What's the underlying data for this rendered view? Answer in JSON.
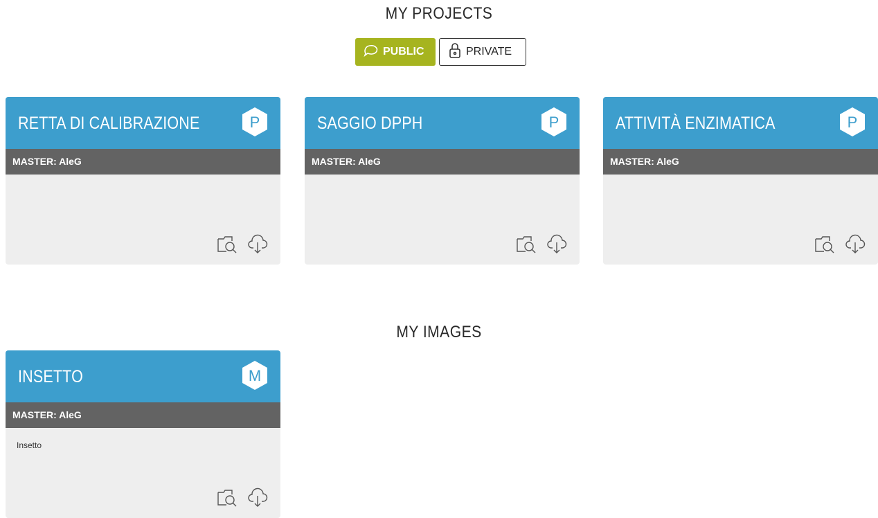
{
  "projects": {
    "title": "MY PROJECTS",
    "filters": [
      {
        "label": "PUBLIC",
        "active": true,
        "icon": "chat-bubble-icon"
      },
      {
        "label": "PRIVATE",
        "active": false,
        "icon": "padlock-icon"
      }
    ],
    "cards": [
      {
        "title": "RETTA DI CALIBRAZIONE",
        "badge": "P",
        "master": "MASTER: AleG",
        "description": ""
      },
      {
        "title": "SAGGIO DPPH",
        "badge": "P",
        "master": "MASTER: AleG",
        "description": ""
      },
      {
        "title": "ATTIVITÀ ENZIMATICA",
        "badge": "P",
        "master": "MASTER: AleG",
        "description": ""
      }
    ]
  },
  "images": {
    "title": "MY IMAGES",
    "cards": [
      {
        "title": "INSETTO",
        "badge": "M",
        "master": "MASTER: AleG",
        "description": "Insetto"
      }
    ]
  },
  "colors": {
    "card_header": "#3d9ecd",
    "master_bar": "#636363",
    "card_body": "#eeeeee",
    "public_active": "#a6b41f"
  },
  "icons": {
    "view": "folder-search-icon",
    "download": "cloud-download-icon"
  }
}
